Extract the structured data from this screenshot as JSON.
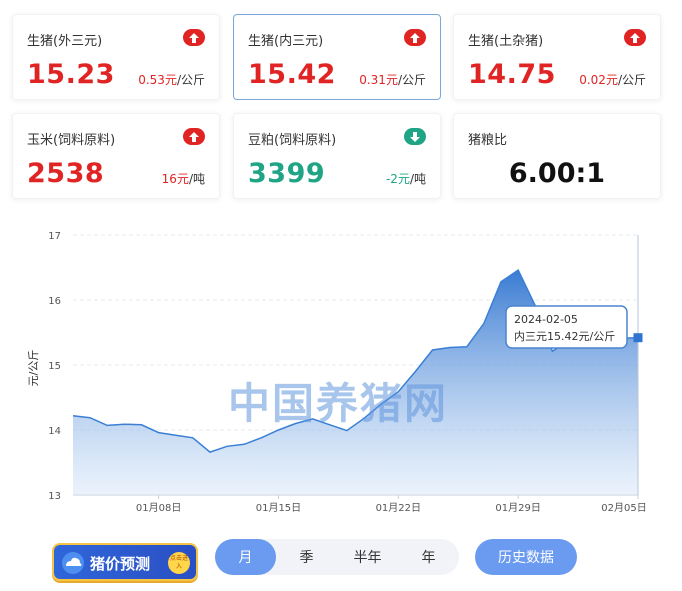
{
  "cards": [
    {
      "title": "生猪(外三元)",
      "value": "15.23",
      "change": "0.53",
      "unit": "元/公斤",
      "trend": "up"
    },
    {
      "title": "生猪(内三元)",
      "value": "15.42",
      "change": "0.31",
      "unit": "元/公斤",
      "trend": "up"
    },
    {
      "title": "生猪(土杂猪)",
      "value": "14.75",
      "change": "0.02",
      "unit": "元/公斤",
      "trend": "up"
    },
    {
      "title": "玉米(饲料原料)",
      "value": "2538",
      "change": "16",
      "unit": "元/吨",
      "trend": "up"
    },
    {
      "title": "豆粕(饲料原料)",
      "value": "3399",
      "change": "-2",
      "unit": "元/吨",
      "trend": "down"
    },
    {
      "title": "猪粮比",
      "value": "6.00:1"
    }
  ],
  "colors": {
    "up": "#e02424",
    "down": "#20a486",
    "accent": "#6b9af1",
    "line": "#3a7fd5"
  },
  "chart_data": {
    "type": "area",
    "ylabel": "元/公斤",
    "ylim": [
      13,
      17
    ],
    "yticks": [
      13,
      14,
      15,
      16,
      17
    ],
    "xlim": [
      "2024-01-03",
      "2024-02-05"
    ],
    "x_tick_labels": [
      {
        "date": "2024-01-08",
        "label": "01月08日"
      },
      {
        "date": "2024-01-15",
        "label": "01月15日"
      },
      {
        "date": "2024-01-22",
        "label": "01月22日"
      },
      {
        "date": "2024-01-29",
        "label": "01月29日"
      },
      {
        "date": "2024-02-05",
        "label": "02月05日"
      }
    ],
    "series": [
      {
        "points": [
          [
            "2024-01-03",
            14.22
          ],
          [
            "2024-01-04",
            14.19
          ],
          [
            "2024-01-05",
            14.07
          ],
          [
            "2024-01-06",
            14.09
          ],
          [
            "2024-01-07",
            14.08
          ],
          [
            "2024-01-08",
            13.96
          ],
          [
            "2024-01-09",
            13.92
          ],
          [
            "2024-01-10",
            13.88
          ],
          [
            "2024-01-11",
            13.66
          ],
          [
            "2024-01-12",
            13.75
          ],
          [
            "2024-01-13",
            13.78
          ],
          [
            "2024-01-14",
            13.88
          ],
          [
            "2024-01-15",
            14.0
          ],
          [
            "2024-01-16",
            14.1
          ],
          [
            "2024-01-17",
            14.17
          ],
          [
            "2024-01-18",
            14.08
          ],
          [
            "2024-01-19",
            13.99
          ],
          [
            "2024-01-20",
            14.18
          ],
          [
            "2024-01-21",
            14.4
          ],
          [
            "2024-01-22",
            14.59
          ],
          [
            "2024-01-23",
            14.9
          ],
          [
            "2024-01-24",
            15.23
          ],
          [
            "2024-01-25",
            15.27
          ],
          [
            "2024-01-26",
            15.28
          ],
          [
            "2024-01-27",
            15.64
          ],
          [
            "2024-01-28",
            16.28
          ],
          [
            "2024-01-29",
            16.46
          ],
          [
            "2024-01-30",
            15.91
          ],
          [
            "2024-01-31",
            15.21
          ],
          [
            "2024-02-01",
            15.38
          ],
          [
            "2024-02-05",
            15.42
          ]
        ]
      }
    ],
    "tooltip": {
      "date": "2024-02-05",
      "text": "内三元15.42元/公斤"
    }
  },
  "watermark": "中国养猪网",
  "badge": {
    "label": "猪价预测",
    "dot": "点击进入"
  },
  "periods": [
    {
      "label": "月",
      "active": true
    },
    {
      "label": "季",
      "active": false
    },
    {
      "label": "半年",
      "active": false
    },
    {
      "label": "年",
      "active": false
    }
  ],
  "history_label": "历史数据"
}
